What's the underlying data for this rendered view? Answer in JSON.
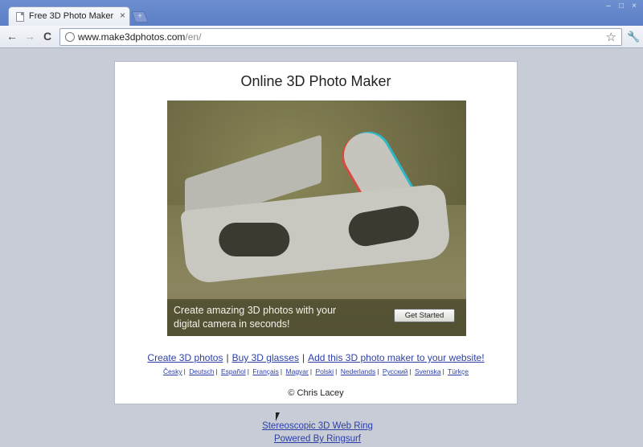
{
  "browser": {
    "tab_title": "Free 3D Photo Maker",
    "tab_close": "×",
    "new_tab": "+",
    "window_controls": [
      "–",
      "□",
      "×"
    ],
    "back_icon": "←",
    "forward_icon": "→",
    "reload_icon": "C",
    "url_host": "www.make3dphotos.com",
    "url_path": "/en/",
    "star_icon": "☆",
    "wrench_icon": "🔧"
  },
  "page": {
    "title": "Online 3D Photo Maker",
    "hero": {
      "caption_line1": "Create amazing 3D photos with your",
      "caption_line2": "digital camera in seconds!",
      "button_label": "Get Started"
    },
    "primary_links": [
      "Create 3D photos",
      "Buy 3D glasses",
      "Add this 3D photo maker to your website!"
    ],
    "language_links": [
      "Česky",
      "Deutsch",
      "Español",
      "Français",
      "Magyar",
      "Polski",
      "Nederlands",
      "Русский",
      "Svenska",
      "Türkçe"
    ],
    "copyright": "© Chris Lacey",
    "footer_links": [
      "Stereoscopic 3D Web Ring",
      "Powered By Ringsurf"
    ],
    "separator": "|"
  }
}
